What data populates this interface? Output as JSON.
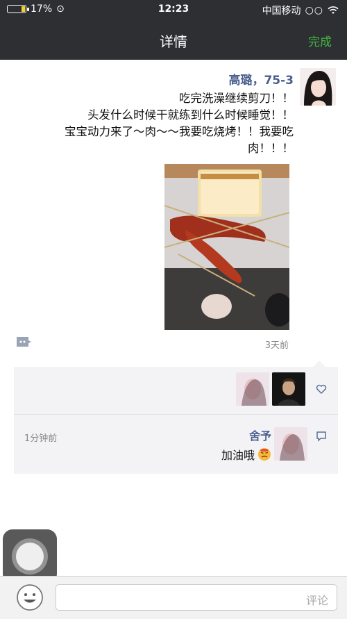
{
  "status_bar": {
    "signal_dots": "○○",
    "carrier": "中国移动",
    "time": "12:23",
    "battery": "17%",
    "battery_level": 0.17
  },
  "nav": {
    "title": "详情",
    "done_label": "完成",
    "done_color": "#3fb83f"
  },
  "post": {
    "author": "高璐，75-3",
    "text_lines": [
      "吃完洗澡继续剪刀！！",
      "头发什么时候干就练到什么时候睡觉！！",
      "宝宝动力来了～肉～～我要吃烧烤！！我要吃",
      "肉！！！"
    ],
    "time": "3天前"
  },
  "interaction": {
    "likes_icon": "heart-icon",
    "comment_icon": "comment-icon",
    "comment": {
      "name": "舍予",
      "text": "加油哦",
      "time": "1分钟前"
    }
  },
  "input": {
    "placeholder": "评论"
  },
  "colors": {
    "bar_bg": "#2e2f33",
    "name_blue": "#4b5f8f",
    "panel_bg": "#f3f3f5"
  }
}
